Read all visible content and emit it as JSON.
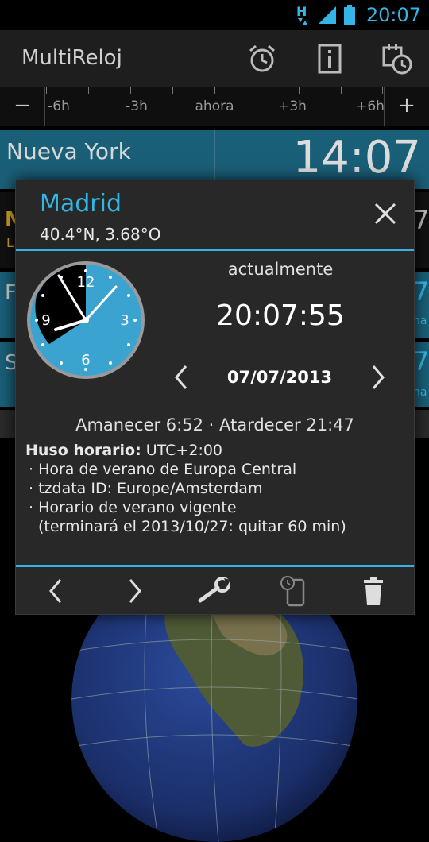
{
  "status_bar": {
    "time": "20:07",
    "accent": "#33b5e5"
  },
  "action_bar": {
    "title": "MultiReloj",
    "icons": [
      "alarm-icon",
      "info-icon",
      "calendar-clock-icon"
    ]
  },
  "timeline": {
    "minus_label": "−",
    "plus_label": "+",
    "labels": [
      "-6h",
      "-3h",
      "ahora",
      "+3h",
      "+6h"
    ]
  },
  "list": {
    "row_ny": {
      "city": "Nueva York",
      "time": "14:07"
    },
    "partial_fragments": [
      "M",
      "L",
      "F",
      "S",
      "7",
      "7",
      "7",
      "7",
      "na",
      "na"
    ]
  },
  "dialog": {
    "city": "Madrid",
    "coords": "40.4°N, 3.68°O",
    "currently_label": "actualmente",
    "time": "20:07:55",
    "date": "07/07/2013",
    "clock_numbers": [
      "12",
      "3",
      "6",
      "9"
    ],
    "sunrise_sunset": "Amanecer 6:52 · Atardecer 21:47",
    "timezone": {
      "heading": "Huso horario:",
      "value": "UTC+2:00",
      "lines": [
        "· Hora de verano de Europa Central",
        "· tzdata ID: Europe/Amsterdam",
        "· Horario de verano vigente",
        "(terminará el 2013/10/27: quitar 60 min)"
      ]
    },
    "buttons": [
      "prev-icon",
      "next-icon",
      "wrench-icon",
      "phone-clock-icon",
      "trash-icon"
    ]
  },
  "colors": {
    "accent": "#33b5e5",
    "row_bg": "#1a5f78",
    "dialog_bg": "#282828",
    "clock_face": "#3aa3cf",
    "highlight_yellow": "#d4a020"
  }
}
